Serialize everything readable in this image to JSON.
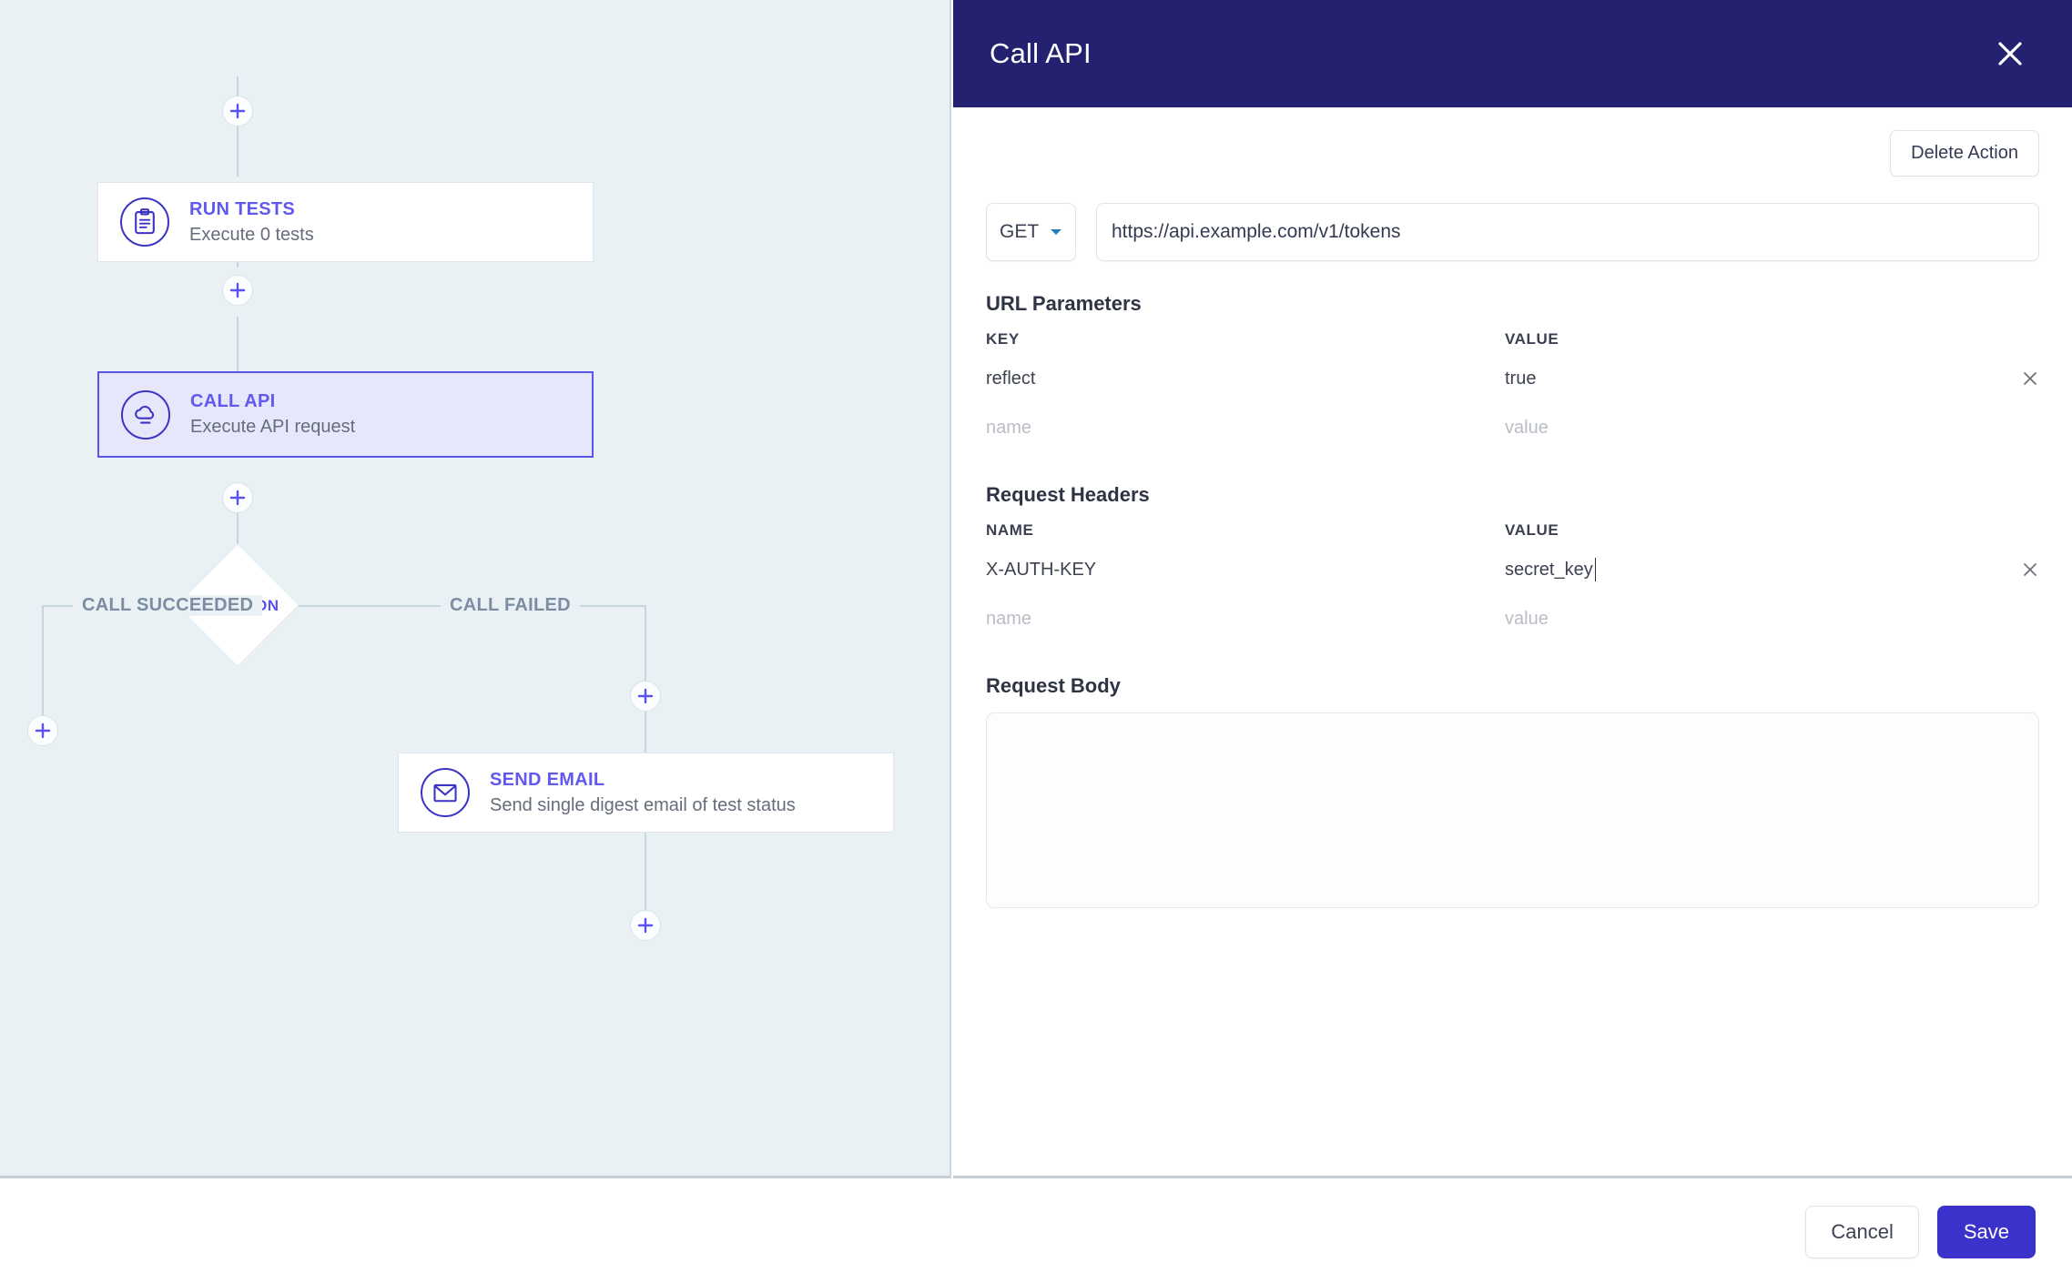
{
  "colors": {
    "header_navy": "#232170",
    "accent_purple": "#6159ef",
    "save_button": "#3b32cc",
    "canvas_bg": "#eaf1f4",
    "selected_node_bg": "#e6e7fb",
    "selected_node_border": "#5b54e8",
    "branch_label": "#7b8ca3",
    "connector": "#c6d6dd"
  },
  "canvas": {
    "nodes": [
      {
        "id": "run-tests",
        "icon": "clipboard-icon",
        "title": "RUN TESTS",
        "subtitle": "Execute 0 tests",
        "selected": false
      },
      {
        "id": "call-api",
        "icon": "cloud-icon",
        "title": "CALL API",
        "subtitle": "Execute API request",
        "selected": true
      },
      {
        "id": "send-email",
        "icon": "envelope-icon",
        "title": "SEND EMAIL",
        "subtitle": "Send single digest email of test status",
        "selected": false
      }
    ],
    "decision": {
      "label": "DECISION",
      "left_branch": "CALL SUCCEEDED",
      "right_branch": "CALL FAILED"
    },
    "add_buttons": [
      {
        "name": "add-step-top"
      },
      {
        "name": "add-step-after-run-tests"
      },
      {
        "name": "add-step-after-call-api"
      },
      {
        "name": "add-step-succeeded-branch"
      },
      {
        "name": "add-step-failed-branch"
      },
      {
        "name": "add-step-after-send-email"
      }
    ],
    "icon_glyph": "plus-icon"
  },
  "panel": {
    "title": "Call API",
    "close_icon": "close-icon",
    "delete_action_label": "Delete Action",
    "request": {
      "method": "GET",
      "method_caret_icon": "chevron-down-icon",
      "url": "https://api.example.com/v1/tokens",
      "url_placeholder": "https://"
    },
    "url_parameters": {
      "section_label": "URL Parameters",
      "columns": [
        "KEY",
        "VALUE"
      ],
      "rows": [
        {
          "key": "reflect",
          "value": "true",
          "removable": true
        }
      ],
      "empty_row": {
        "key_placeholder": "name",
        "value_placeholder": "value"
      },
      "remove_icon": "close-icon"
    },
    "request_headers": {
      "section_label": "Request Headers",
      "columns": [
        "NAME",
        "VALUE"
      ],
      "rows": [
        {
          "key": "X-AUTH-KEY",
          "value": "secret_key",
          "removable": true,
          "focused": true
        }
      ],
      "empty_row": {
        "key_placeholder": "name",
        "value_placeholder": "value"
      },
      "remove_icon": "close-icon"
    },
    "request_body": {
      "section_label": "Request Body",
      "value": "",
      "placeholder": ""
    }
  },
  "footer": {
    "cancel_label": "Cancel",
    "save_label": "Save"
  }
}
